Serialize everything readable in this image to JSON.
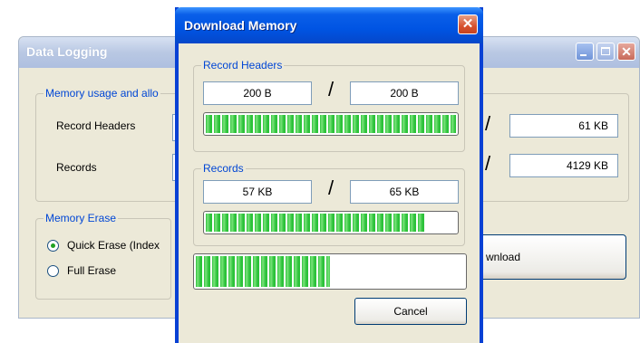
{
  "background_window": {
    "title": "Data Logging",
    "memory_group": {
      "legend": "Memory usage and allo",
      "record_headers_label": "Record Headers",
      "records_label": "Records",
      "record_headers_total": "61 KB",
      "records_total": "4129 KB"
    },
    "erase_group": {
      "legend": "Memory Erase",
      "quick_erase_label": "Quick Erase (Index",
      "full_erase_label": "Full Erase",
      "selected": "quick"
    },
    "download_button_label": "wnload",
    "separator": "/"
  },
  "dialog": {
    "title": "Download Memory",
    "record_headers": {
      "legend": "Record Headers",
      "current": "200 B",
      "total": "200 B",
      "progress": 1.0
    },
    "records": {
      "legend": "Records",
      "current": "57 KB",
      "total": "65 KB",
      "progress": 0.88
    },
    "overall_progress": 0.5,
    "cancel_label": "Cancel",
    "separator": "/"
  },
  "colors": {
    "dialog_title_bar": "#0054e3",
    "progress_green": "#2cc23a",
    "group_legend_blue": "#0046d5"
  }
}
